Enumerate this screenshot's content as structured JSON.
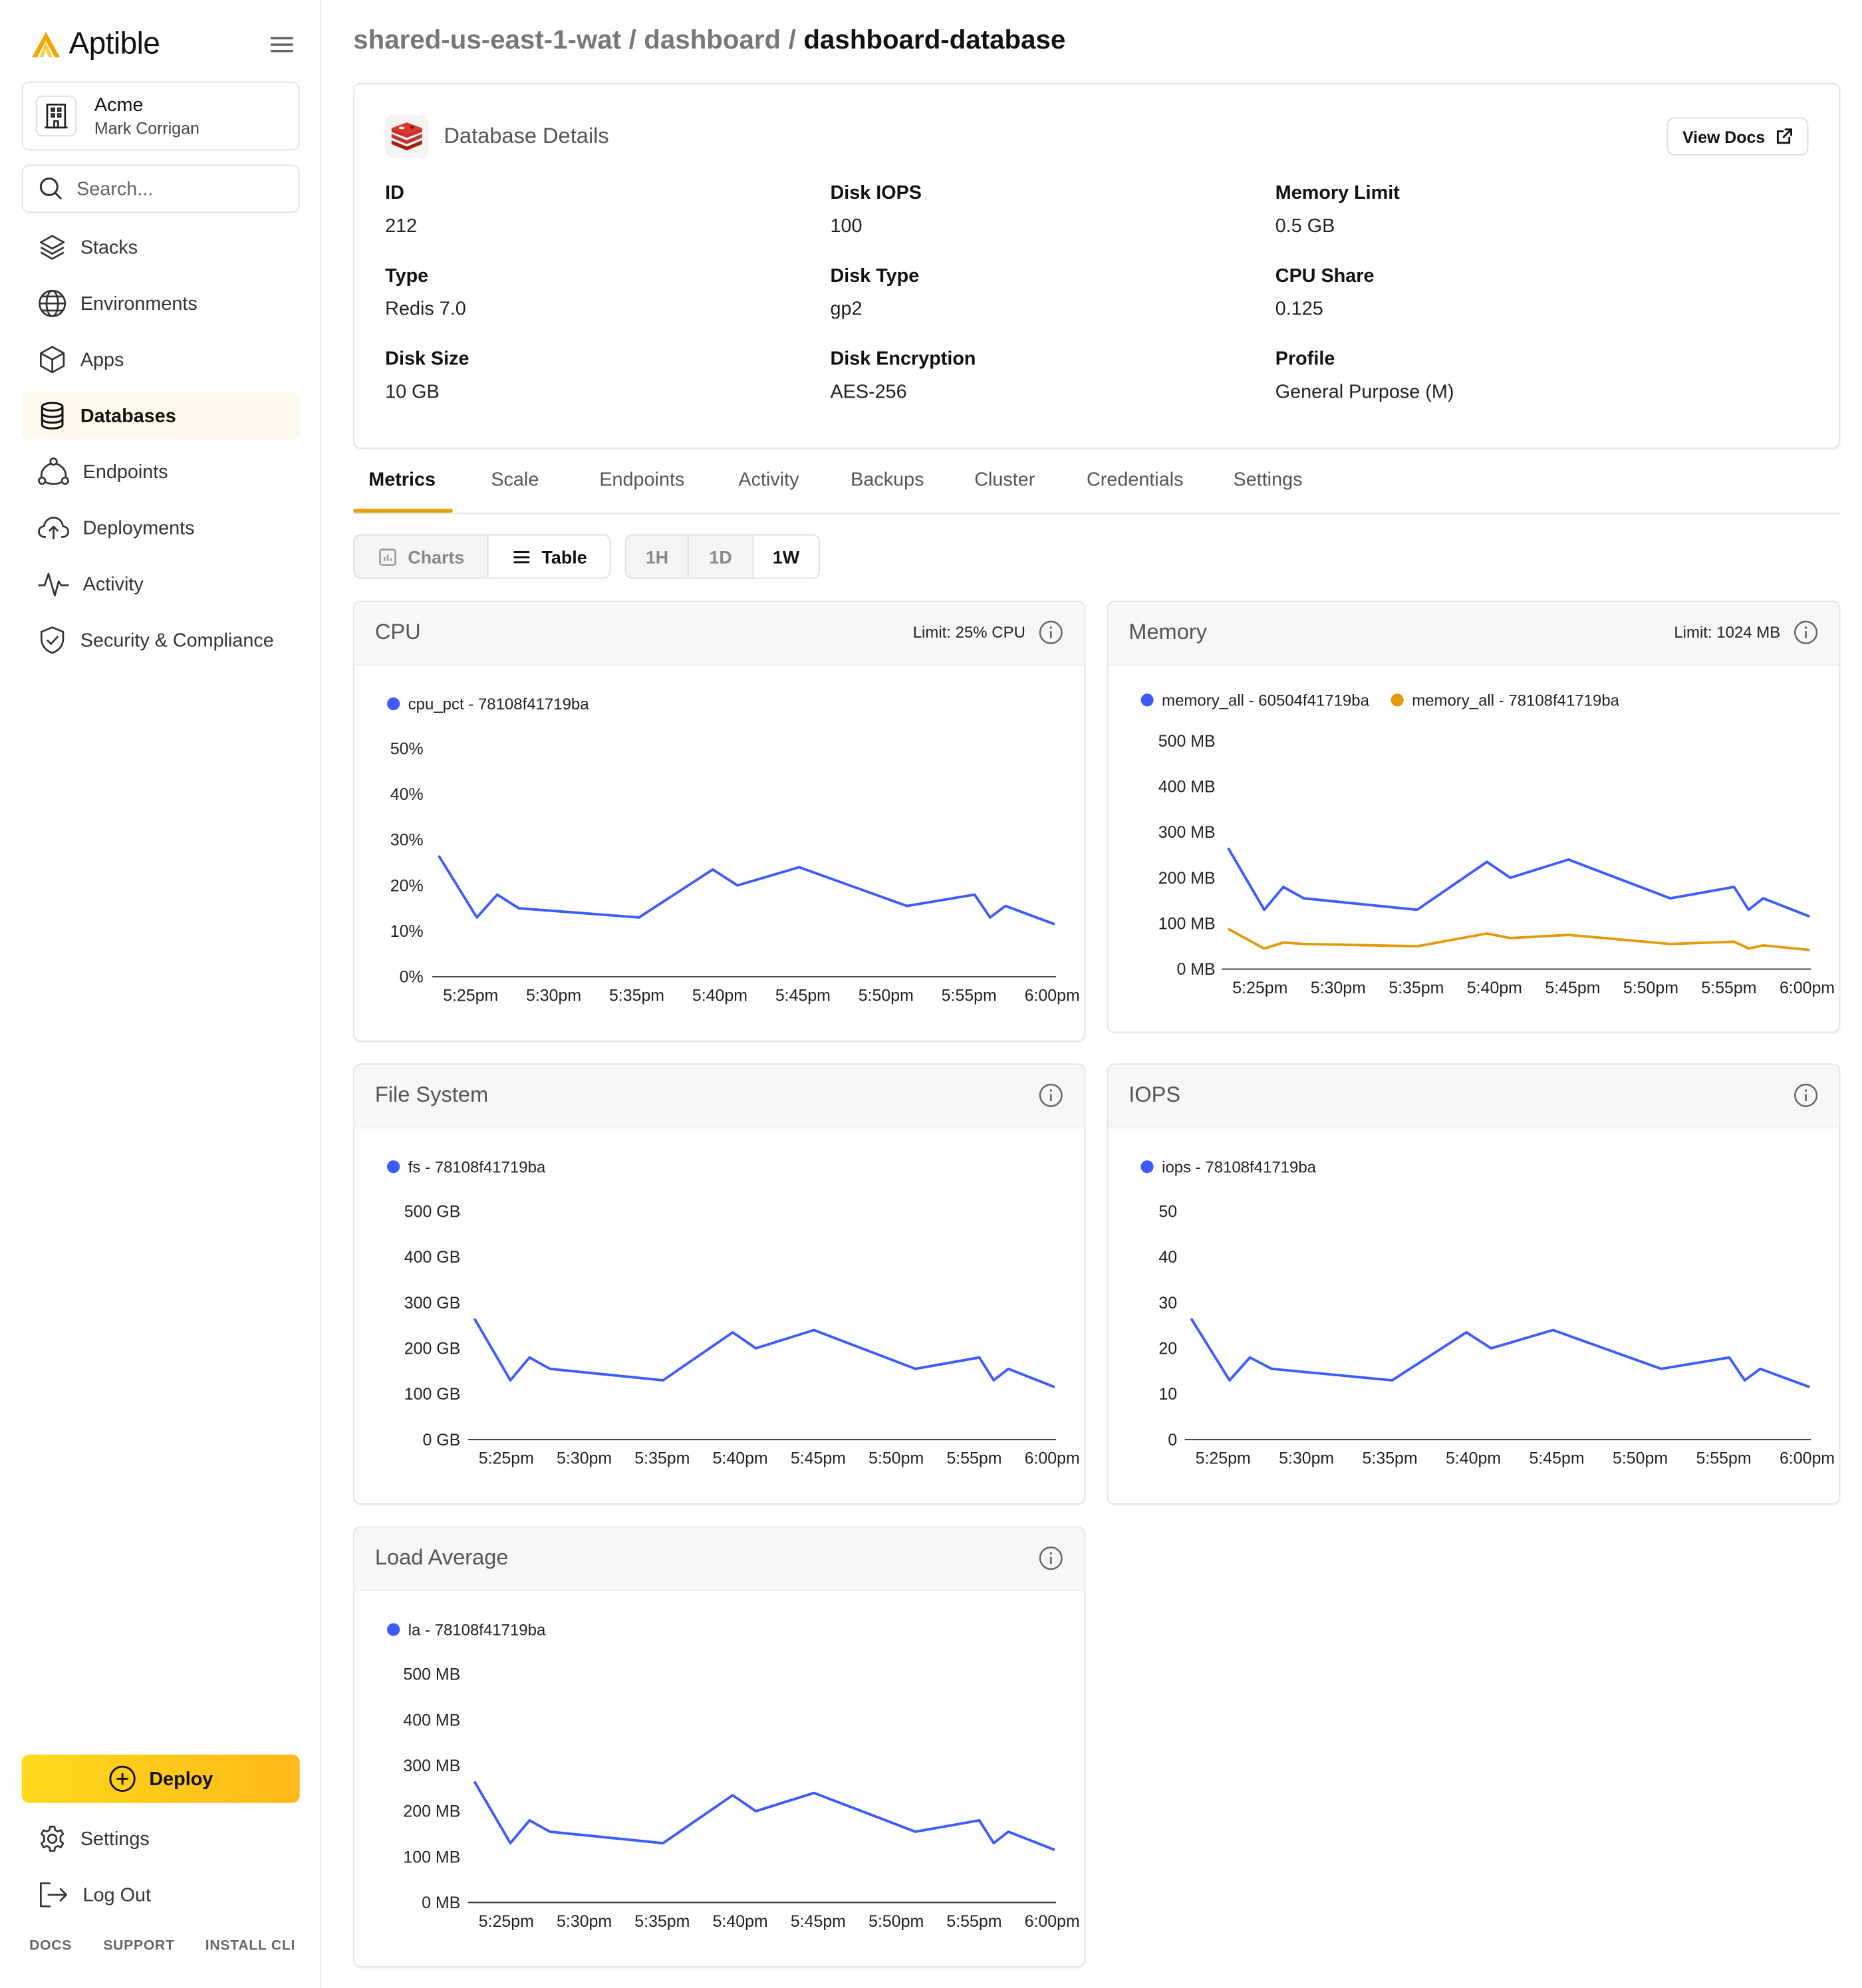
{
  "brand": {
    "name": "Aptible",
    "accent": "#f5a300"
  },
  "org": {
    "name": "Acme",
    "user": "Mark Corrigan"
  },
  "search": {
    "placeholder": "Search..."
  },
  "nav": {
    "items": [
      {
        "label": "Stacks",
        "icon": "stacks-icon"
      },
      {
        "label": "Environments",
        "icon": "globe-icon"
      },
      {
        "label": "Apps",
        "icon": "cube-icon"
      },
      {
        "label": "Databases",
        "icon": "database-icon",
        "active": true
      },
      {
        "label": "Endpoints",
        "icon": "endpoints-icon"
      },
      {
        "label": "Deployments",
        "icon": "cloud-upload-icon"
      },
      {
        "label": "Activity",
        "icon": "activity-icon"
      },
      {
        "label": "Security & Compliance",
        "icon": "shield-check-icon"
      }
    ]
  },
  "deploy": {
    "label": "Deploy"
  },
  "bottom_nav": {
    "settings": "Settings",
    "logout": "Log Out"
  },
  "footer": {
    "docs": "DOCS",
    "support": "SUPPORT",
    "install_cli": "INSTALL CLI"
  },
  "breadcrumb": {
    "stack": "shared-us-east-1-wat",
    "env": "dashboard",
    "db": "dashboard-database",
    "sep": "/"
  },
  "details": {
    "title": "Database Details",
    "view_docs": "View Docs",
    "fields": [
      {
        "label": "ID",
        "value": "212"
      },
      {
        "label": "Disk IOPS",
        "value": "100"
      },
      {
        "label": "Memory Limit",
        "value": "0.5 GB"
      },
      {
        "label": "Type",
        "value": "Redis 7.0"
      },
      {
        "label": "Disk Type",
        "value": "gp2"
      },
      {
        "label": "CPU Share",
        "value": "0.125"
      },
      {
        "label": "Disk Size",
        "value": "10 GB"
      },
      {
        "label": "Disk Encryption",
        "value": "AES-256"
      },
      {
        "label": "Profile",
        "value": "General Purpose (M)"
      }
    ]
  },
  "tabs": [
    "Metrics",
    "Scale",
    "Endpoints",
    "Activity",
    "Backups",
    "Cluster",
    "Credentials",
    "Settings"
  ],
  "active_tab": "Metrics",
  "view_toggle": {
    "charts": "Charts",
    "table": "Table",
    "selected": "Table"
  },
  "range_toggle": {
    "options": [
      "1H",
      "1D",
      "1W"
    ],
    "selected": "1W"
  },
  "colors": {
    "series_blue": "#3b5bfd",
    "series_orange": "#e39a0b"
  },
  "chart_data": [
    {
      "id": "cpu",
      "title": "CPU",
      "limit": "Limit: 25% CPU",
      "type": "line",
      "x": [
        "5:25pm",
        "5:30pm",
        "5:35pm",
        "5:40pm",
        "5:45pm",
        "5:50pm",
        "5:55pm",
        "6:00pm"
      ],
      "yticks": [
        "50%",
        "40%",
        "30%",
        "20%",
        "10%",
        "0%"
      ],
      "ylim": [
        0,
        50
      ],
      "series": [
        {
          "name": "cpu_pct - 78108f41719ba",
          "color": "#3b5bfd",
          "values": [
            26.5,
            13,
            18,
            15,
            13,
            23.5,
            20,
            24,
            15.5,
            18,
            13,
            15.5,
            11.5
          ]
        }
      ]
    },
    {
      "id": "memory",
      "title": "Memory",
      "limit": "Limit: 1024 MB",
      "type": "line",
      "x": [
        "5:25pm",
        "5:30pm",
        "5:35pm",
        "5:40pm",
        "5:45pm",
        "5:50pm",
        "5:55pm",
        "6:00pm"
      ],
      "yticks": [
        "500 MB",
        "400 MB",
        "300 MB",
        "200 MB",
        "100 MB",
        "0 MB"
      ],
      "ylim": [
        0,
        500
      ],
      "series": [
        {
          "name": "memory_all - 60504f41719ba",
          "color": "#3b5bfd",
          "values": [
            265,
            130,
            180,
            155,
            130,
            235,
            200,
            240,
            155,
            180,
            130,
            155,
            115
          ]
        },
        {
          "name": "memory_all - 78108f41719ba",
          "color": "#e39a0b",
          "values": [
            88,
            45,
            58,
            55,
            50,
            78,
            68,
            75,
            55,
            60,
            45,
            52,
            42
          ]
        }
      ]
    },
    {
      "id": "fs",
      "title": "File System",
      "limit": "",
      "type": "line",
      "x": [
        "5:25pm",
        "5:30pm",
        "5:35pm",
        "5:40pm",
        "5:45pm",
        "5:50pm",
        "5:55pm",
        "6:00pm"
      ],
      "yticks": [
        "500 GB",
        "400 GB",
        "300 GB",
        "200 GB",
        "100 GB",
        "0 GB"
      ],
      "ylim": [
        0,
        500
      ],
      "series": [
        {
          "name": "fs - 78108f41719ba",
          "color": "#3b5bfd",
          "values": [
            265,
            130,
            180,
            155,
            130,
            235,
            200,
            240,
            155,
            180,
            130,
            155,
            115
          ]
        }
      ]
    },
    {
      "id": "iops",
      "title": "IOPS",
      "limit": "",
      "type": "line",
      "x": [
        "5:25pm",
        "5:30pm",
        "5:35pm",
        "5:40pm",
        "5:45pm",
        "5:50pm",
        "5:55pm",
        "6:00pm"
      ],
      "yticks": [
        "50",
        "40",
        "30",
        "20",
        "10",
        "0"
      ],
      "ylim": [
        0,
        50
      ],
      "series": [
        {
          "name": "iops - 78108f41719ba",
          "color": "#3b5bfd",
          "values": [
            26.5,
            13,
            18,
            15.5,
            13,
            23.5,
            20,
            24,
            15.5,
            18,
            13,
            15.5,
            11.5
          ]
        }
      ]
    },
    {
      "id": "la",
      "title": "Load Average",
      "limit": "",
      "type": "line",
      "x": [
        "5:25pm",
        "5:30pm",
        "5:35pm",
        "5:40pm",
        "5:45pm",
        "5:50pm",
        "5:55pm",
        "6:00pm"
      ],
      "yticks": [
        "500 MB",
        "400 MB",
        "300 MB",
        "200 MB",
        "100 MB",
        "0 MB"
      ],
      "ylim": [
        0,
        500
      ],
      "series": [
        {
          "name": "la - 78108f41719ba",
          "color": "#3b5bfd",
          "values": [
            265,
            130,
            180,
            155,
            130,
            235,
            200,
            240,
            155,
            180,
            130,
            155,
            115
          ]
        }
      ]
    }
  ]
}
